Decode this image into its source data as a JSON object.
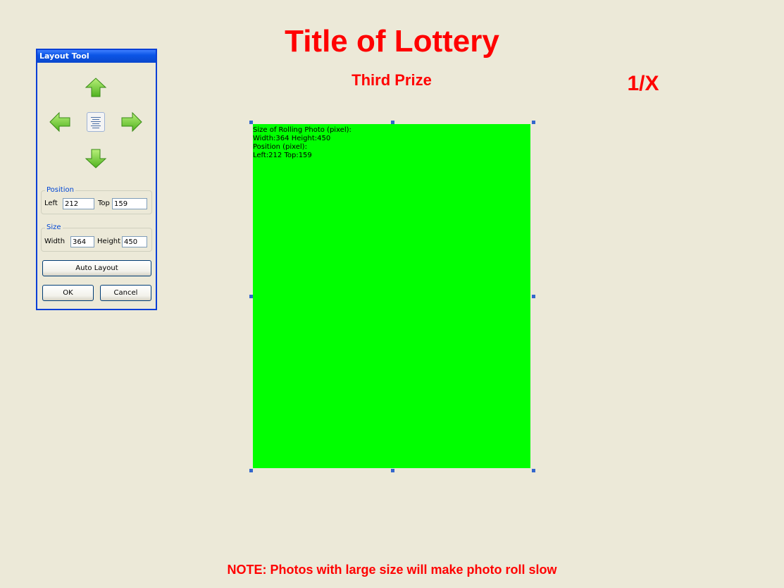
{
  "header": {
    "title": "Title of Lottery",
    "prize": "Third Prize",
    "counter": "1/X"
  },
  "photo": {
    "info_lines": [
      "Size of Rolling Photo (pixel):",
      "Width:364  Height:450",
      "Position (pixel):",
      "Left:212  Top:159"
    ],
    "color": "#00ff00"
  },
  "layout_tool": {
    "title": "Layout Tool",
    "icons": {
      "up": "arrow-up-icon",
      "down": "arrow-down-icon",
      "left": "arrow-left-icon",
      "right": "arrow-right-icon",
      "center": "align-center-icon"
    },
    "position": {
      "label": "Position",
      "left_label": "Left",
      "left_value": "212",
      "top_label": "Top",
      "top_value": "159"
    },
    "size": {
      "label": "Size",
      "width_label": "Width",
      "width_value": "364",
      "height_label": "Height",
      "height_value": "450"
    },
    "buttons": {
      "auto_layout": "Auto Layout",
      "ok": "OK",
      "cancel": "Cancel"
    }
  },
  "footer": {
    "note": "NOTE: Photos with large size will make photo roll slow"
  },
  "colors": {
    "accent_text": "#ff0000",
    "background": "#ece9d8",
    "photo": "#00ff00",
    "handle": "#3366cc",
    "titlebar": "#0b55e6"
  }
}
